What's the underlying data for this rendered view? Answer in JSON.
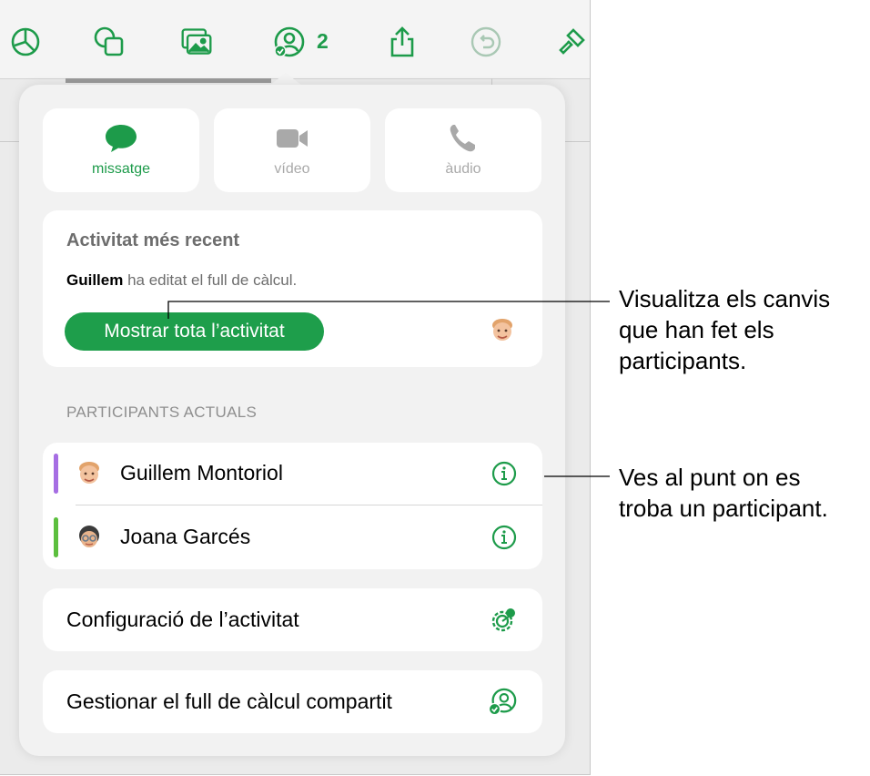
{
  "toolbar": {
    "icons": [
      "chart-icon",
      "shapes-icon",
      "media-icon",
      "collaborate-icon",
      "share-icon",
      "undo-icon",
      "format-brush-icon"
    ],
    "participant_count": "2",
    "accent_color": "#1d9b4a"
  },
  "comm_buttons": {
    "message": "missatge",
    "video": "vídeo",
    "audio": "àudio"
  },
  "recent_activity": {
    "title": "Activitat més recent",
    "actor": "Guillem",
    "action": " ha editat el full de càlcul.",
    "show_all_label": "Mostrar tota l’activitat"
  },
  "participants": {
    "header": "PARTICIPANTS ACTUALS",
    "list": [
      {
        "name": "Guillem Montoriol",
        "color": "#a66ee3"
      },
      {
        "name": "Joana Garcés",
        "color": "#5cbf3e"
      }
    ]
  },
  "settings": {
    "activity_settings": "Configuració de l’activitat",
    "manage_shared": "Gestionar el full de càlcul compartit"
  },
  "callouts": {
    "activity": [
      "Visualitza els canvis",
      "que han fet els",
      "participants."
    ],
    "participant": [
      "Ves al punt on es",
      "troba un participant."
    ]
  }
}
